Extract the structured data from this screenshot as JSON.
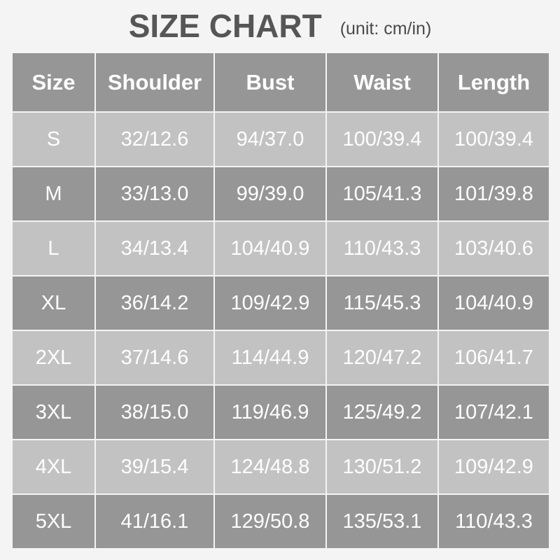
{
  "title": {
    "main": "SIZE CHART",
    "unit": "(unit: cm/in)"
  },
  "colors": {
    "background": "#f4f4f4",
    "header_bg": "#969696",
    "row_dark_bg": "#969696",
    "row_light_bg": "#c2c2c2",
    "cell_text": "#ffffff",
    "title_text": "#565656",
    "gridline": "#f4f4f4"
  },
  "table": {
    "columns": [
      "Size",
      "Shoulder",
      "Bust",
      "Waist",
      "Length"
    ],
    "rows": [
      {
        "size": "S",
        "shoulder": "32/12.6",
        "bust": "94/37.0",
        "waist": "100/39.4",
        "length": "100/39.4"
      },
      {
        "size": "M",
        "shoulder": "33/13.0",
        "bust": "99/39.0",
        "waist": "105/41.3",
        "length": "101/39.8"
      },
      {
        "size": "L",
        "shoulder": "34/13.4",
        "bust": "104/40.9",
        "waist": "110/43.3",
        "length": "103/40.6"
      },
      {
        "size": "XL",
        "shoulder": "36/14.2",
        "bust": "109/42.9",
        "waist": "115/45.3",
        "length": "104/40.9"
      },
      {
        "size": "2XL",
        "shoulder": "37/14.6",
        "bust": "114/44.9",
        "waist": "120/47.2",
        "length": "106/41.7"
      },
      {
        "size": "3XL",
        "shoulder": "38/15.0",
        "bust": "119/46.9",
        "waist": "125/49.2",
        "length": "107/42.1"
      },
      {
        "size": "4XL",
        "shoulder": "39/15.4",
        "bust": "124/48.8",
        "waist": "130/51.2",
        "length": "109/42.9"
      },
      {
        "size": "5XL",
        "shoulder": "41/16.1",
        "bust": "129/50.8",
        "waist": "135/53.1",
        "length": "110/43.3"
      }
    ]
  }
}
